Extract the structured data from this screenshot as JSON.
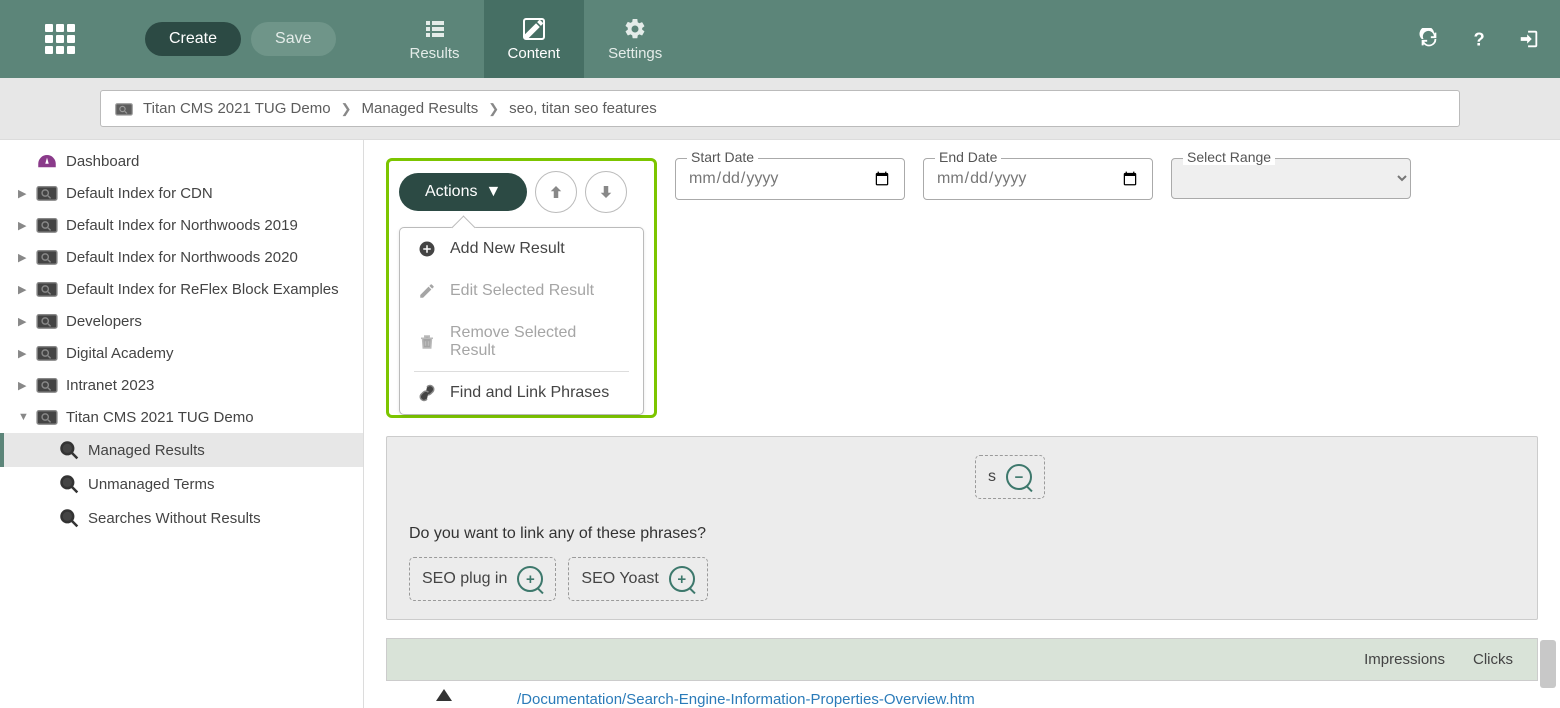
{
  "header": {
    "create": "Create",
    "save": "Save",
    "tabs": {
      "results": "Results",
      "content": "Content",
      "settings": "Settings"
    }
  },
  "breadcrumb": {
    "seg1": "Titan CMS 2021 TUG Demo",
    "seg2": "Managed Results",
    "seg3": "seo, titan seo features"
  },
  "sidebar": {
    "dashboard": "Dashboard",
    "items": [
      "Default Index for CDN",
      "Default Index for Northwoods 2019",
      "Default Index for Northwoods 2020",
      "Default Index for ReFlex Block Examples",
      "Developers",
      "Digital Academy",
      "Intranet 2023",
      "Titan CMS 2021 TUG Demo"
    ],
    "children": {
      "managed": "Managed Results",
      "unmanaged": "Unmanaged Terms",
      "noresults": "Searches Without Results"
    }
  },
  "toolbar": {
    "actions": "Actions",
    "menu": {
      "add": "Add New Result",
      "edit": "Edit Selected Result",
      "remove": "Remove Selected Result",
      "find": "Find and Link Phrases"
    },
    "start_label": "Start Date",
    "end_label": "End Date",
    "range_label": "Select Range",
    "date_placeholder": "mm/dd/yyyy"
  },
  "panel": {
    "q1": "Do you want to link any of these phrases?",
    "chip1": "SEO plug in",
    "chip2": "SEO Yoast"
  },
  "table": {
    "impressions": "Impressions",
    "clicks": "Clicks",
    "link": "/Documentation/Search-Engine-Information-Properties-Overview.htm"
  }
}
